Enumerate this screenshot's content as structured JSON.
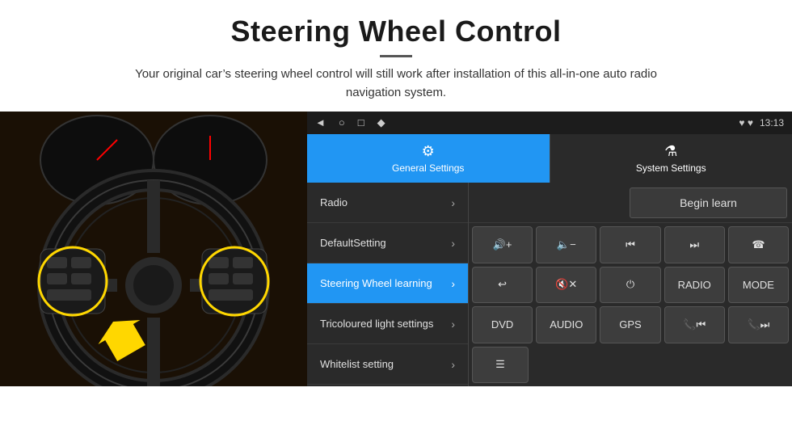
{
  "header": {
    "title": "Steering Wheel Control",
    "divider": true,
    "subtitle": "Your original car’s steering wheel control will still work after installation of this all-in-one auto radio navigation system."
  },
  "status_bar": {
    "icons": [
      "◄",
      "○",
      "□",
      "♦"
    ],
    "right_icons": "♥ ♥",
    "time": "13:13"
  },
  "tabs": [
    {
      "id": "general",
      "label": "General Settings",
      "icon": "⚙",
      "active": true
    },
    {
      "id": "system",
      "label": "System Settings",
      "icon": "⚗",
      "active": false
    }
  ],
  "menu": [
    {
      "id": "radio",
      "label": "Radio",
      "active": false
    },
    {
      "id": "default-setting",
      "label": "DefaultSetting",
      "active": false
    },
    {
      "id": "steering-wheel",
      "label": "Steering Wheel learning",
      "active": true
    },
    {
      "id": "tricoloured",
      "label": "Tricoloured light settings",
      "active": false
    },
    {
      "id": "whitelist",
      "label": "Whitelist setting",
      "active": false
    }
  ],
  "begin_learn": {
    "label": "Begin learn"
  },
  "control_buttons": {
    "row1": [
      {
        "id": "vol-up",
        "label": "🔊+",
        "symbol": "🔊+"
      },
      {
        "id": "vol-down",
        "label": "🔈-",
        "symbol": "🔈-"
      },
      {
        "id": "prev-track",
        "label": "⏮",
        "symbol": "⏮"
      },
      {
        "id": "next-track",
        "label": "⏭",
        "symbol": "⏭"
      },
      {
        "id": "phone",
        "label": "☎",
        "symbol": "☎"
      }
    ],
    "row2": [
      {
        "id": "hang-up",
        "label": "☎↓",
        "symbol": "↩"
      },
      {
        "id": "mute",
        "label": "🔇×",
        "symbol": "🔇"
      },
      {
        "id": "power",
        "label": "⏻",
        "symbol": "⏻"
      },
      {
        "id": "radio-btn",
        "label": "RADIO",
        "symbol": "RADIO"
      },
      {
        "id": "mode-btn",
        "label": "MODE",
        "symbol": "MODE"
      }
    ],
    "row3": [
      {
        "id": "dvd-btn",
        "label": "DVD",
        "symbol": "DVD"
      },
      {
        "id": "audio-btn",
        "label": "AUDIO",
        "symbol": "AUDIO"
      },
      {
        "id": "gps-btn",
        "label": "GPS",
        "symbol": "GPS"
      },
      {
        "id": "prev-combo",
        "label": "☎⏮",
        "symbol": "📞⏮"
      },
      {
        "id": "next-combo",
        "label": "☎⏭",
        "symbol": "📞⏭"
      }
    ],
    "row4": [
      {
        "id": "list-icon",
        "label": "☰",
        "symbol": "☰"
      }
    ]
  }
}
